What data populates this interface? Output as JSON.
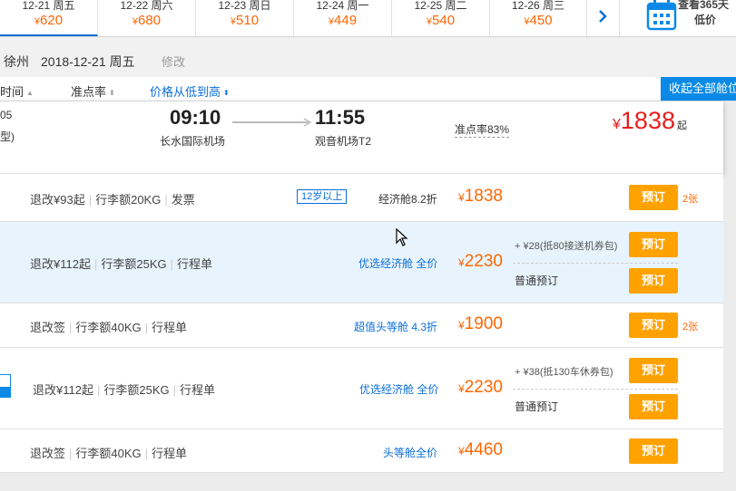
{
  "date_strip": {
    "dates": [
      {
        "date": "12-21 周五",
        "price": "620",
        "active": true
      },
      {
        "date": "12-22 周六",
        "price": "680",
        "active": false
      },
      {
        "date": "12-23 周日",
        "price": "510",
        "active": false
      },
      {
        "date": "12-24 周一",
        "price": "449",
        "active": false
      },
      {
        "date": "12-25 周二",
        "price": "540",
        "active": false
      },
      {
        "date": "12-26 周三",
        "price": "450",
        "active": false
      }
    ],
    "currency": "¥",
    "next_icon": "chevron-right-icon",
    "calendar_icon": "calendar-icon",
    "calendar_label_line1": "查看365天",
    "calendar_label_line2": "低价"
  },
  "route": {
    "city": "徐州",
    "date": "2018-12-21 周五",
    "edit_label": "修改"
  },
  "sort": {
    "time_label": "时间",
    "otp_label": "准点率",
    "price_label": "价格从低到高",
    "collapse_label": "收起全部舱位"
  },
  "flight": {
    "code": "05",
    "type": "型)",
    "dep_time": "09:10",
    "arr_time": "11:55",
    "dep_airport": "长水国际机场",
    "arr_airport": "观音机场T2",
    "otp": "准点率83%",
    "currency": "¥",
    "lowest_price": "1838",
    "qi": "起"
  },
  "cabins": [
    {
      "rules": [
        "退改¥93起",
        "行李额20KG",
        "发票"
      ],
      "age_tag": "12岁以上",
      "cabin": "经济舱8.2折",
      "cabin_style": "plain",
      "price": "1838",
      "book": "预订",
      "remain": "2张"
    },
    {
      "rules": [
        "退改¥112起",
        "行李额25KG",
        "行程单"
      ],
      "cabin": "优选经济舱 全价",
      "cabin_style": "blue",
      "price": "2230",
      "package": "+ ¥28(抵80接送机券包)",
      "normal": "普通预订",
      "book": "预订",
      "book2": "预订"
    },
    {
      "rules": [
        "退改签",
        "行李额40KG",
        "行程单"
      ],
      "cabin": "超值头等舱 4.3折",
      "cabin_style": "blue",
      "price": "1900",
      "book": "预订",
      "remain": "2张"
    },
    {
      "rules": [
        "退改¥112起",
        "行李额25KG",
        "行程单"
      ],
      "cabin": "优选经济舱 全价",
      "cabin_style": "blue",
      "price": "2230",
      "package": "+ ¥38(抵130车休券包)",
      "normal": "普通预订",
      "book": "预订",
      "book2": "预订"
    },
    {
      "rules": [
        "退改签",
        "行李额40KG",
        "行程单"
      ],
      "cabin": "头等舱全价",
      "cabin_style": "blue",
      "price": "4460",
      "book": "预订"
    }
  ],
  "colors": {
    "accent": "#0a6fd8",
    "price": "#ff6600",
    "lowest": "#e61e1e",
    "book": "#ffa200"
  }
}
